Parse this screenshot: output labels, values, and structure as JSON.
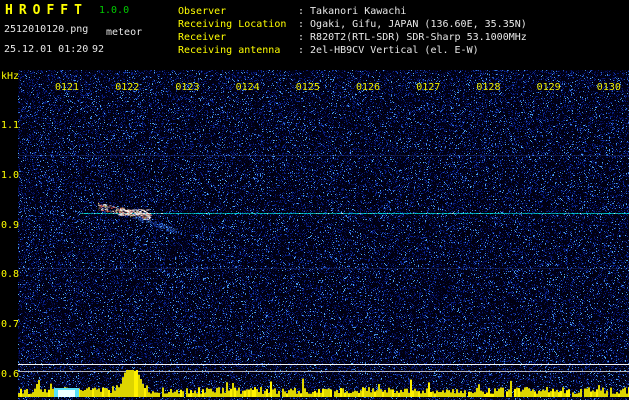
{
  "app": {
    "title": "HROFFT",
    "version": "1.0.0",
    "filename": "2512010120.png",
    "mode": "meteor",
    "datetime": "25.12.01 01:20",
    "count": "92"
  },
  "station": {
    "rows": [
      {
        "label": "Observer",
        "value": ": Takanori Kawachi"
      },
      {
        "label": "Receiving Location",
        "value": ": Ogaki, Gifu, JAPAN (136.60E, 35.35N)"
      },
      {
        "label": "Receiver",
        "value": ": R820T2(RTL-SDR) SDR-Sharp 53.1000MHz"
      },
      {
        "label": "Receiving antenna",
        "value": ": 2el-HB9CV Vertical (el. E-W)"
      }
    ]
  },
  "colors": {
    "accent_yellow": "#ffff00",
    "version_green": "#00cc00",
    "text_white": "#e8e8e8",
    "carrier_cyan": "#00dcdc",
    "level_yellow": "#ddd500",
    "noise_base": "#000814"
  },
  "chart_data": {
    "type": "heatmap",
    "title": "HROFFT meteor echo spectrogram",
    "x_ticks": [
      "0121",
      "0122",
      "0123",
      "0124",
      "0125",
      "0126",
      "0127",
      "0128",
      "0129",
      "0130"
    ],
    "x_range": [
      "01:20",
      "01:30"
    ],
    "y_unit": "kHz",
    "y_ticks": [
      "1.1",
      "1.0",
      "0.9",
      "0.8",
      "0.7",
      "0.6"
    ],
    "y_range_khz": [
      0.55,
      1.15
    ],
    "background": "dark blue random noise speckle",
    "features": [
      {
        "name": "carrier-line",
        "type": "horizontal_line",
        "freq_khz": 0.93,
        "color": "#00dcdc",
        "time_start": "01:21",
        "time_end": "01:30"
      },
      {
        "name": "meteor-echo",
        "type": "doppler_streak",
        "time": "01:22",
        "freq_start_khz": 0.95,
        "freq_end_khz": 0.87,
        "head_colors": [
          "#ffffff",
          "#ff6050",
          "#ffe870"
        ],
        "tail_color": "#4080ff"
      },
      {
        "name": "reference-lines",
        "type": "horizontal_lines",
        "freqs_khz": [
          0.62,
          0.61
        ],
        "color": "#ffffff"
      },
      {
        "name": "signal-level-graph",
        "type": "area",
        "color": "#ddd500",
        "position": "bottom",
        "peak_time": "01:22",
        "strong_patch_time": "01:21"
      }
    ]
  }
}
